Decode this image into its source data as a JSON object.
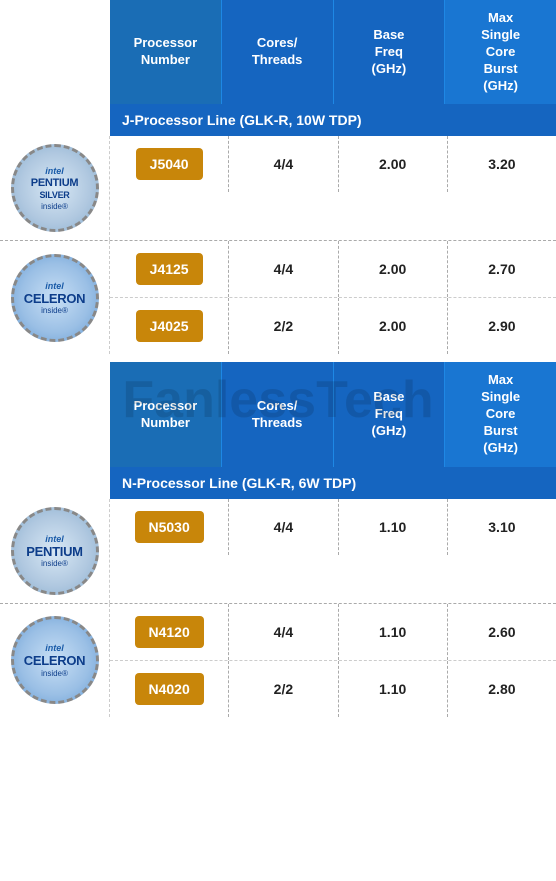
{
  "watermark": "FanlessTech",
  "tables": [
    {
      "id": "j-table",
      "header": {
        "cols": [
          {
            "label": "Processor\nNumber"
          },
          {
            "label": "Cores/\nThreads"
          },
          {
            "label": "Base\nFreq\n(GHz)"
          },
          {
            "label": "Max\nSingle\nCore\nBurst\n(GHz)"
          }
        ]
      },
      "section_label": "J-Processor Line (GLK-R, 10W TDP)",
      "groups": [
        {
          "logo": "pentium_silver",
          "brand": "PENTIUM\nSILVER",
          "rows": [
            {
              "proc": "J5040",
              "cores": "4/4",
              "base": "2.00",
              "burst": "3.20"
            }
          ]
        },
        {
          "logo": "celeron",
          "brand": "CELERON",
          "rows": [
            {
              "proc": "J4125",
              "cores": "4/4",
              "base": "2.00",
              "burst": "2.70"
            },
            {
              "proc": "J4025",
              "cores": "2/2",
              "base": "2.00",
              "burst": "2.90"
            }
          ]
        }
      ]
    },
    {
      "id": "n-table",
      "header": {
        "cols": [
          {
            "label": "Processor\nNumber"
          },
          {
            "label": "Cores/\nThreads"
          },
          {
            "label": "Base\nFreq\n(GHz)"
          },
          {
            "label": "Max\nSingle\nCore\nBurst\n(GHz)"
          }
        ]
      },
      "section_label": "N-Processor Line (GLK-R, 6W TDP)",
      "groups": [
        {
          "logo": "pentium_silver",
          "brand": "PENTIUM",
          "rows": [
            {
              "proc": "N5030",
              "cores": "4/4",
              "base": "1.10",
              "burst": "3.10"
            }
          ]
        },
        {
          "logo": "celeron",
          "brand": "CELERON",
          "rows": [
            {
              "proc": "N4120",
              "cores": "4/4",
              "base": "1.10",
              "burst": "2.60"
            },
            {
              "proc": "N4020",
              "cores": "2/2",
              "base": "1.10",
              "burst": "2.80"
            }
          ]
        }
      ]
    }
  ]
}
